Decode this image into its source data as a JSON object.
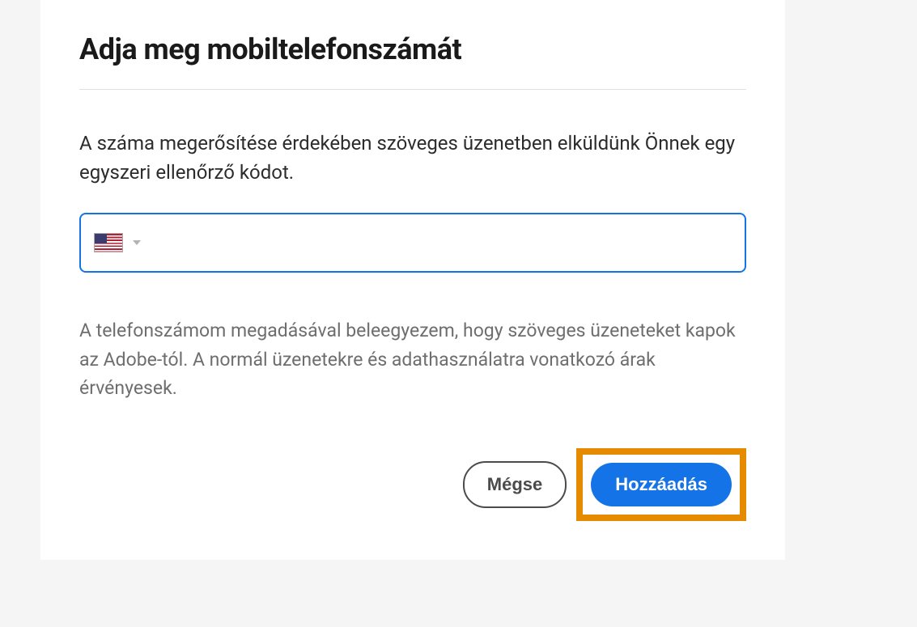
{
  "dialog": {
    "title": "Adja meg mobiltelefonszámát",
    "description": "A száma megerősítése érdekében szöveges üzenetben elküldünk Önnek egy egyszeri ellenőrző kódot.",
    "phone_input": {
      "country": "US",
      "value": ""
    },
    "disclaimer": "A telefonszámom megadásával beleegyezem, hogy szöveges üzeneteket kapok az Adobe-tól. A normál üzenetekre és adathasználatra vonatkozó árak érvényesek.",
    "buttons": {
      "cancel": "Mégse",
      "add": "Hozzáadás"
    }
  },
  "colors": {
    "accent": "#1473e6",
    "highlight": "#e68a00"
  }
}
